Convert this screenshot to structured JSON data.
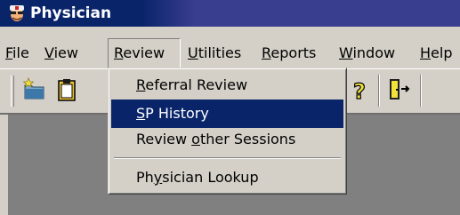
{
  "window": {
    "title": "Physician",
    "colors": {
      "titlebar": "#0a246a",
      "face": "#d4d0c8",
      "workspace": "#808080",
      "selection": "#0a246a"
    }
  },
  "menubar": {
    "items": [
      {
        "pre": "",
        "key": "F",
        "post": "ile"
      },
      {
        "pre": "",
        "key": "V",
        "post": "iew"
      },
      {
        "pre": "",
        "key": "R",
        "post": "eview"
      },
      {
        "pre": "",
        "key": "U",
        "post": "tilities"
      },
      {
        "pre": "",
        "key": "R",
        "post": "eports"
      },
      {
        "pre": "",
        "key": "W",
        "post": "indow"
      },
      {
        "pre": "",
        "key": "H",
        "post": "elp"
      }
    ]
  },
  "toolbar": {
    "icons": [
      "new-folder-icon",
      "clipboard-icon",
      "help-icon",
      "exit-door-icon"
    ]
  },
  "review_menu": {
    "items": [
      {
        "pre": "",
        "key": "R",
        "post": "eferral Review",
        "selected": false
      },
      {
        "pre": "",
        "key": "S",
        "post": "P History",
        "selected": true
      },
      {
        "pre": "Review ",
        "key": "o",
        "post": "ther Sessions",
        "selected": false
      },
      {
        "pre": "Ph",
        "key": "y",
        "post": "sician Lookup",
        "selected": false
      }
    ]
  }
}
